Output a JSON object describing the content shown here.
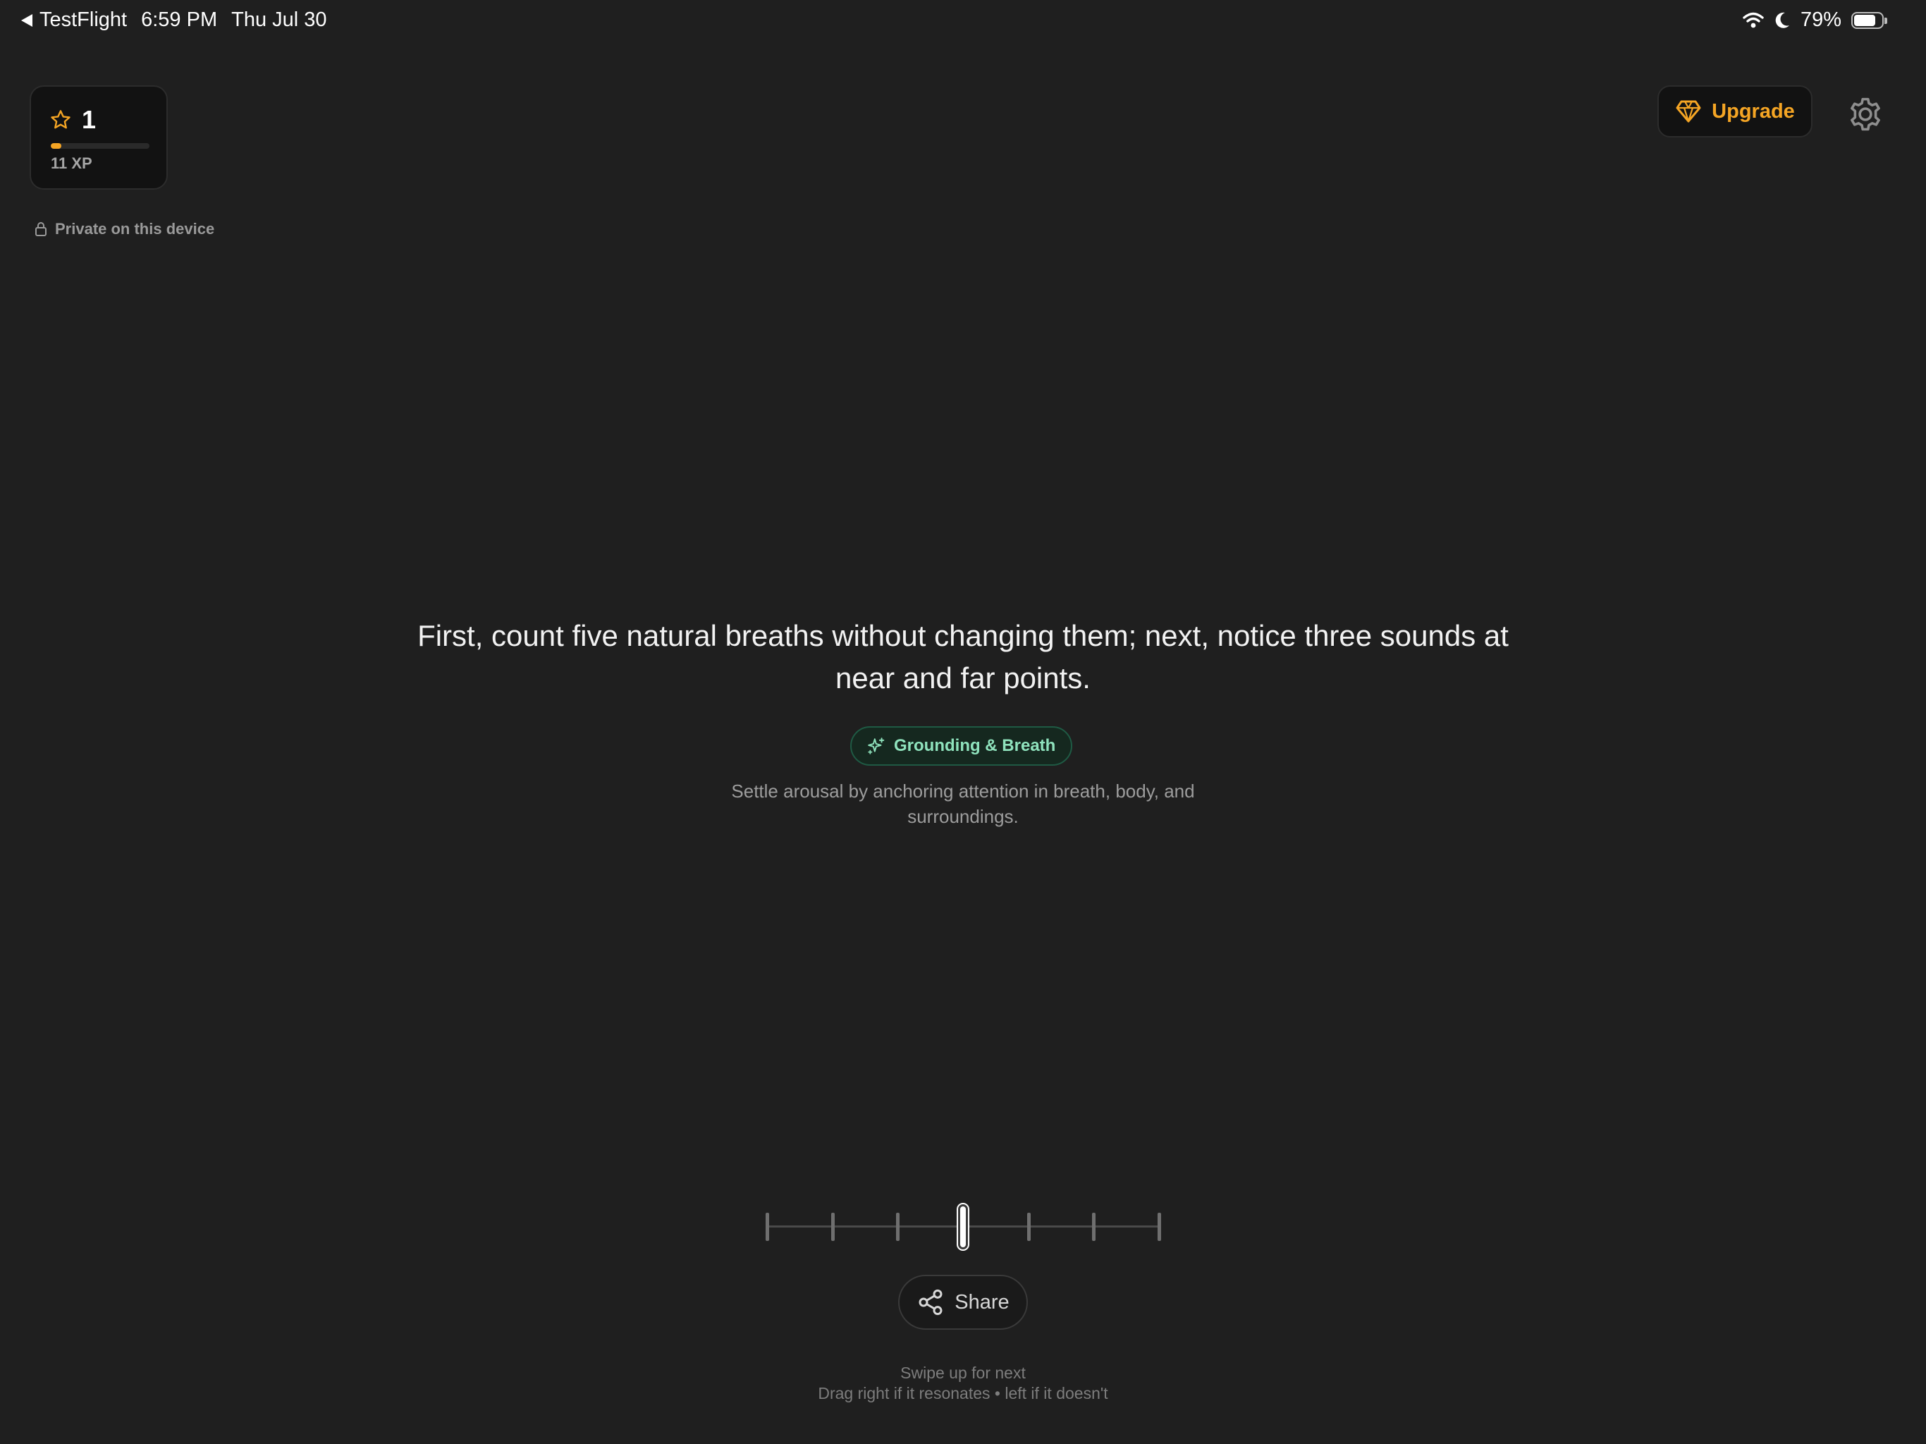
{
  "status_bar": {
    "back_app": "TestFlight",
    "time": "6:59 PM",
    "date": "Thu Jul 30",
    "battery_percent": "79%",
    "battery_level": 0.79
  },
  "xp_card": {
    "level": "1",
    "xp_label": "11 XP",
    "progress": 0.11,
    "accent_color": "#f5a524"
  },
  "privacy": {
    "label": "Private on this device"
  },
  "header": {
    "upgrade_label": "Upgrade"
  },
  "main": {
    "prompt": "First, count five natural breaths without changing them; next, notice three sounds at near and far points.",
    "category": "Grounding & Breath",
    "category_color": "#8fe3bd",
    "description": "Settle arousal by anchoring attention in breath, body, and surroundings."
  },
  "rating_slider": {
    "tick_count": 7,
    "selected_index": 3
  },
  "share": {
    "label": "Share"
  },
  "hints": {
    "line1": "Swipe up for next",
    "line2": "Drag right if it resonates • left if it doesn't"
  },
  "icons": [
    "back-triangle-icon",
    "wifi-icon",
    "moon-icon",
    "battery-icon",
    "star-icon",
    "lock-icon",
    "diamond-icon",
    "gear-icon",
    "sparkle-icon",
    "share-icon"
  ]
}
